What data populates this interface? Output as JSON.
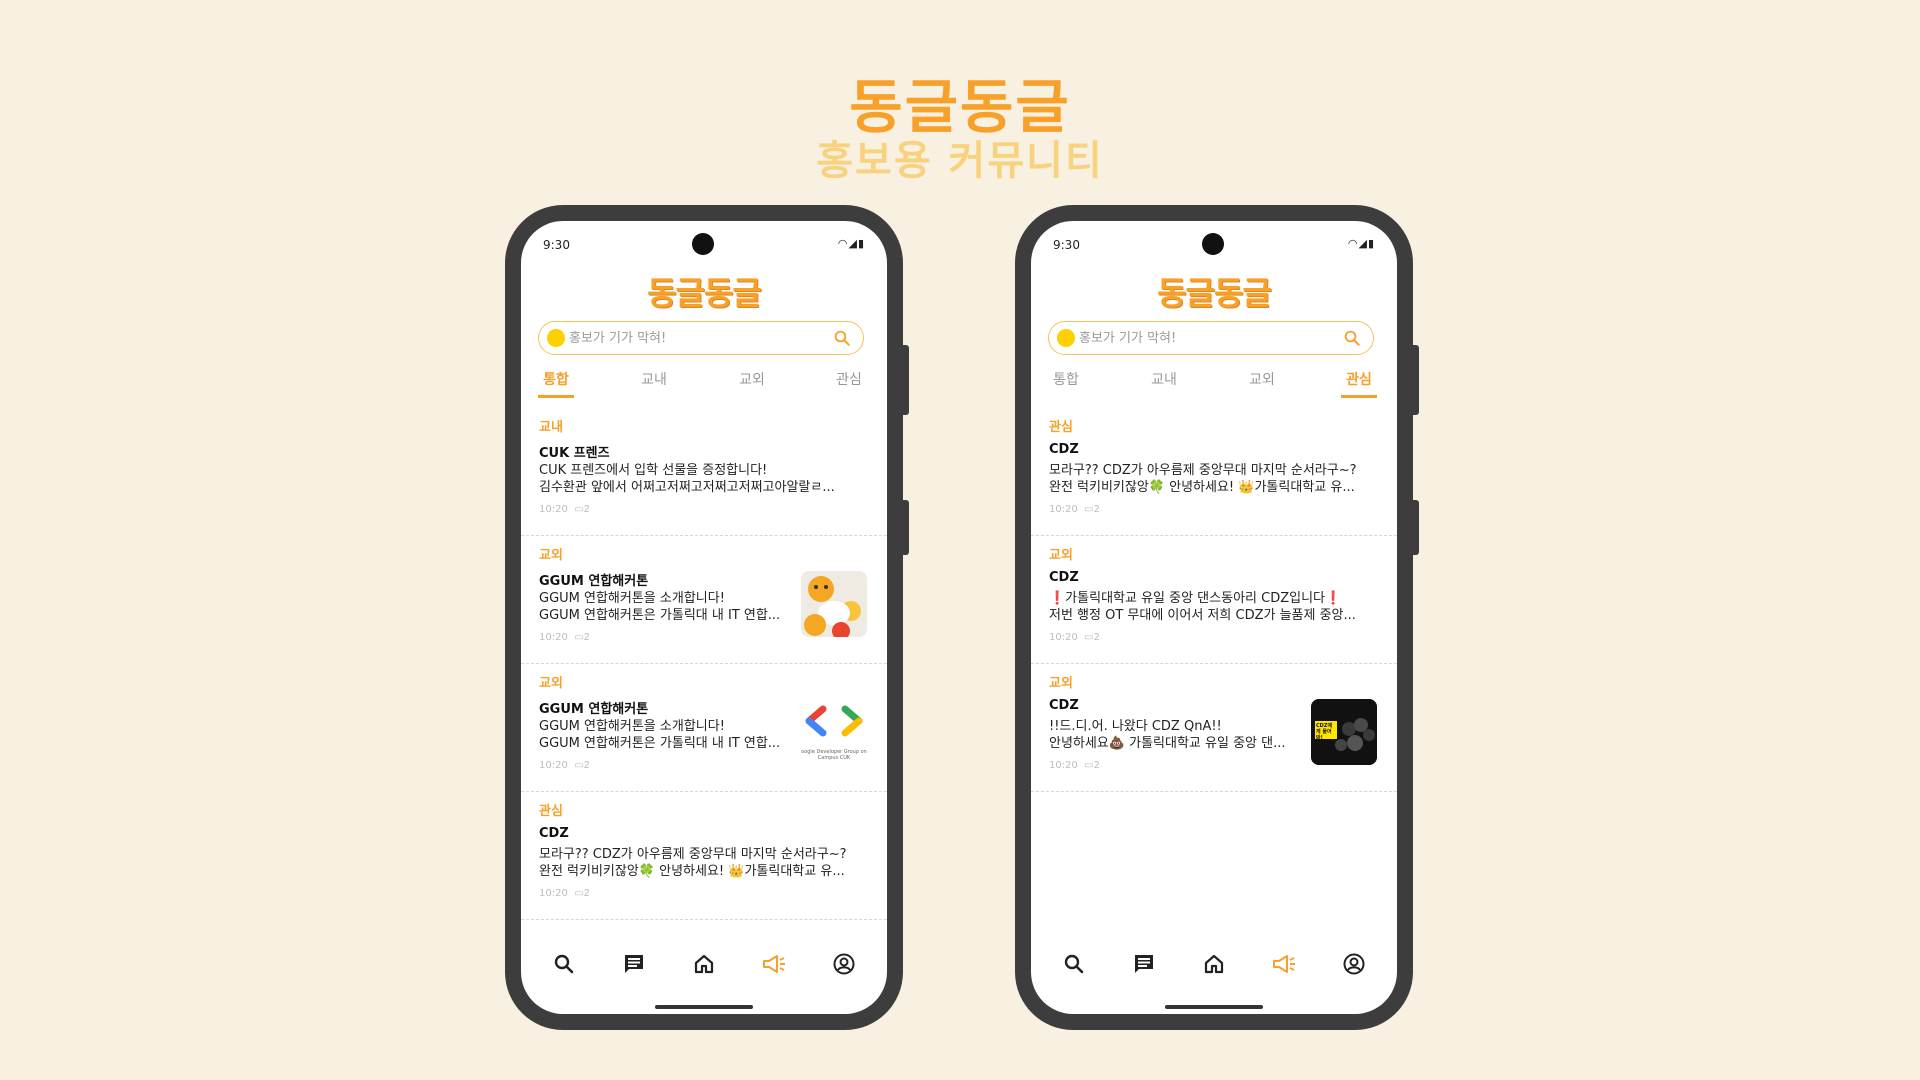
{
  "hero": {
    "title": "동글동글",
    "subtitle": "홍보용 커뮤니티"
  },
  "colors": {
    "accent": "#f7a12a",
    "accent_light": "#f9d27f",
    "background": "#f8f0e0",
    "phone_frame": "#3d3d3d"
  },
  "phones": [
    {
      "status_time": "9:30",
      "app_logo": "동글동글",
      "search_placeholder": "홍보가 기가 막혀!",
      "tabs": [
        "통합",
        "교내",
        "교외",
        "관심"
      ],
      "active_tab": "통합",
      "posts": [
        {
          "category": "교내",
          "author": "CUK 프렌즈",
          "line1": "CUK 프렌즈에서 입학 선물을 증정합니다!",
          "line2": "김수환관 앞에서 어쩌고저쩌고저쩌고저쩌고아알랄ㄹ...",
          "time": "10:20",
          "comments": "2",
          "thumbnail": null
        },
        {
          "category": "교외",
          "author": "GGUM 연합해커톤",
          "line1": "GGUM 연합해커톤을 소개합니다!",
          "line2": "GGUM 연합해커톤은 가톨릭대 내 IT 연합...",
          "time": "10:20",
          "comments": "2",
          "thumbnail": "kakao-friends-image"
        },
        {
          "category": "교외",
          "author": "GGUM 연합해커톤",
          "line1": "GGUM 연합해커톤을 소개합니다!",
          "line2": "GGUM 연합해커톤은 가톨릭대 내 IT 연합...",
          "time": "10:20",
          "comments": "2",
          "thumbnail": "gdsc-logo-image",
          "thumbnail_caption": "oogle Developer Group on Campus CUK"
        },
        {
          "category": "관심",
          "author": "CDZ",
          "line1": "모라구?? CDZ가 아우름제 중앙무대 마지막 순서라구~?",
          "line2": "완전 럭키비키잖앙🍀 안녕하세요! 👑가톨릭대학교 유...",
          "time": "10:20",
          "comments": "2",
          "thumbnail": null
        }
      ]
    },
    {
      "status_time": "9:30",
      "app_logo": "동글동글",
      "search_placeholder": "홍보가 기가 막혀!",
      "tabs": [
        "통합",
        "교내",
        "교외",
        "관심"
      ],
      "active_tab": "관심",
      "posts": [
        {
          "category": "관심",
          "author": "CDZ",
          "line1": "모라구?? CDZ가 아우름제 중앙무대 마지막 순서라구~?",
          "line2": "완전 럭키비키잖앙🍀 안녕하세요! 👑가톨릭대학교 유...",
          "time": "10:20",
          "comments": "2",
          "thumbnail": null
        },
        {
          "category": "교외",
          "author": "CDZ",
          "line1": "❗가톨릭대학교 유일 중앙 댄스동아리 CDZ입니다❗",
          "line2": "저번 행정 OT 무대에 이어서 저희 CDZ가 늘품제 중앙...",
          "time": "10:20",
          "comments": "2",
          "thumbnail": null
        },
        {
          "category": "교외",
          "author": "CDZ",
          "line1": "!!드.디.어. 나왔다 CDZ QnA!!",
          "line2": "안녕하세요💩 가톨릭대학교 유일 중앙 댄...",
          "time": "10:20",
          "comments": "2",
          "thumbnail": "cdz-qna-image",
          "thumbnail_caption": "CDZ에게 물어봐!"
        }
      ]
    }
  ],
  "bottom_nav": [
    "search-icon",
    "board-icon",
    "home-icon",
    "megaphone-icon",
    "profile-icon"
  ],
  "bottom_nav_active": "megaphone-icon"
}
